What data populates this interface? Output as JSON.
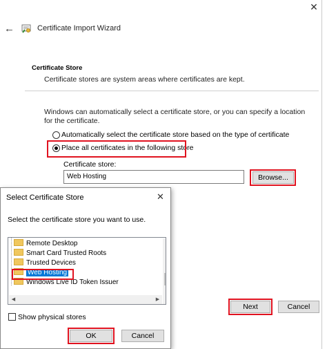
{
  "window": {
    "close_glyph": "✕"
  },
  "wizard": {
    "back_glyph": "←",
    "title": "Certificate Import Wizard",
    "section_title": "Certificate Store",
    "section_subtitle": "Certificate stores are system areas where certificates are kept.",
    "description": "Windows can automatically select a certificate store, or you can specify a location for the certificate.",
    "radio_auto_label": "Automatically select the certificate store based on the type of certificate",
    "radio_auto_selected": false,
    "radio_place_label": "Place all certificates in the following store",
    "radio_place_selected": true,
    "store_label": "Certificate store:",
    "store_value": "Web Hosting",
    "browse_label": "Browse...",
    "next_label": "Next",
    "cancel_label": "Cancel"
  },
  "dialog": {
    "title": "Select Certificate Store",
    "close_glyph": "✕",
    "prompt": "Select the certificate store you want to use.",
    "tree_items": [
      {
        "label": "Remote Desktop",
        "selected": false
      },
      {
        "label": "Smart Card Trusted Roots",
        "selected": false
      },
      {
        "label": "Trusted Devices",
        "selected": false
      },
      {
        "label": "Web Hosting",
        "selected": true
      },
      {
        "label": "Windows Live ID Token Issuer",
        "selected": false
      }
    ],
    "show_physical_label": "Show physical stores",
    "show_physical_checked": false,
    "ok_label": "OK",
    "cancel_label": "Cancel"
  },
  "colors": {
    "highlight": "#e0121f",
    "selection": "#0078d7",
    "folder": "#f0c75e"
  },
  "icons": [
    "close-icon",
    "back-arrow-icon",
    "certificate-icon",
    "folder-icon",
    "scroll-up-icon",
    "scroll-down-icon",
    "scroll-left-icon",
    "scroll-right-icon"
  ]
}
